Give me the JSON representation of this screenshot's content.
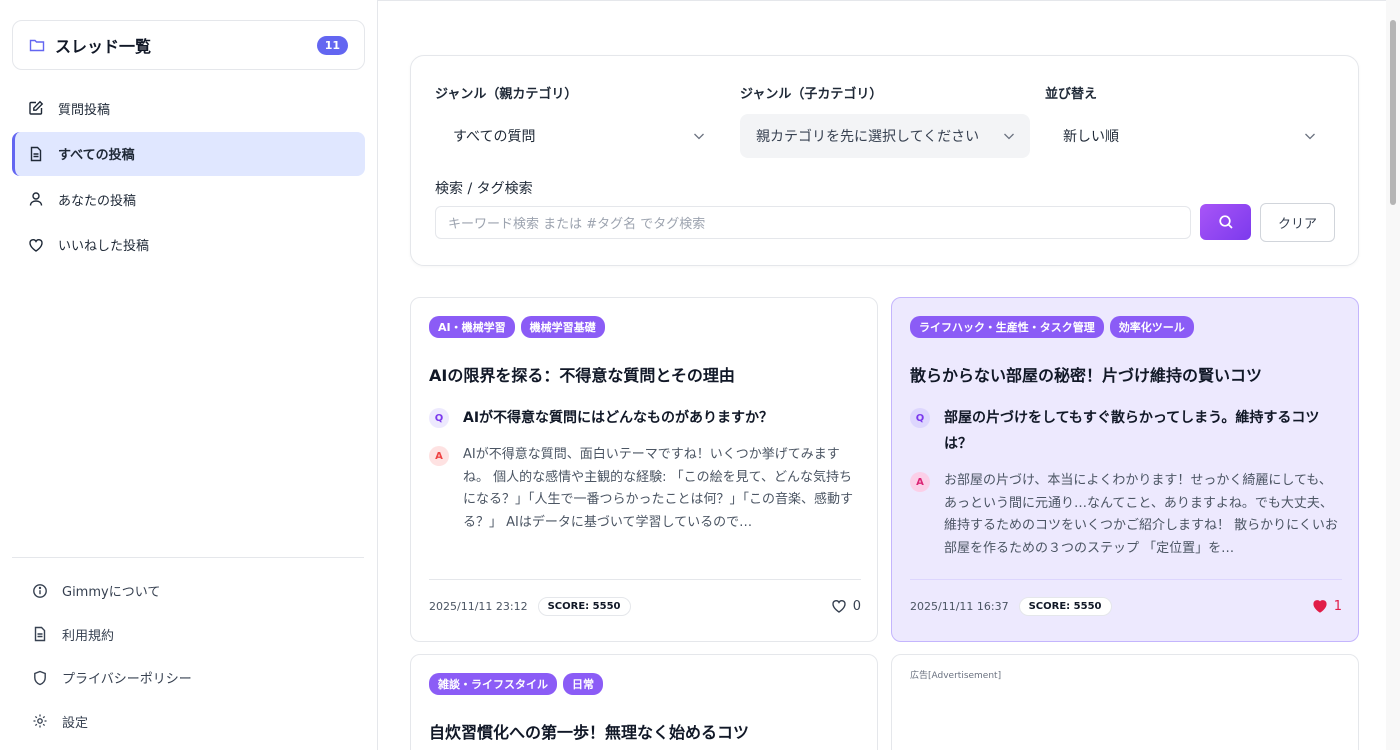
{
  "sidebar": {
    "header": {
      "title": "スレッド一覧",
      "count": "11",
      "icon": "folder-icon"
    },
    "nav": [
      {
        "label": "質問投稿",
        "icon": "edit-icon",
        "active": false
      },
      {
        "label": "すべての投稿",
        "icon": "document-icon",
        "active": true
      },
      {
        "label": "あなたの投稿",
        "icon": "user-icon",
        "active": false
      },
      {
        "label": "いいねした投稿",
        "icon": "heart-icon",
        "active": false
      }
    ],
    "footer": [
      {
        "label": "Gimmyについて",
        "icon": "info-icon"
      },
      {
        "label": "利用規約",
        "icon": "document-icon"
      },
      {
        "label": "プライバシーポリシー",
        "icon": "shield-icon"
      },
      {
        "label": "設定",
        "icon": "gear-icon"
      }
    ]
  },
  "filters": {
    "parent_label": "ジャンル（親カテゴリ）",
    "parent_value": "すべての質問",
    "child_label": "ジャンル（子カテゴリ）",
    "child_value": "親カテゴリを先に選択してください",
    "sort_label": "並び替え",
    "sort_value": "新しい順",
    "search_label": "検索 / タグ検索",
    "search_placeholder": "キーワード検索 または #タグ名 でタグ検索",
    "search_value": "",
    "clear_label": "クリア"
  },
  "posts": [
    {
      "tags": [
        "AI・機械学習",
        "機械学習基礎"
      ],
      "title": "AIの限界を探る：不得意な質問とその理由",
      "q_badge": "Q",
      "question": "AIが不得意な質問にはどんなものがありますか？",
      "a_badge": "A",
      "answer": "AIが不得意な質問、面白いテーマですね！いくつか挙げてみますね。 個人的な感情や主観的な経験: 「この絵を見て、どんな気持ちになる？」「人生で一番つらかったことは何？」「この音楽、感動する？」 AIはデータに基づいて学習しているので…",
      "date": "2025/11/11 23:12",
      "score_label": "SCORE:",
      "score": "5550",
      "likes": "0",
      "liked": false
    },
    {
      "tags": [
        "ライフハック・生産性・タスク管理",
        "効率化ツール"
      ],
      "title": "散らからない部屋の秘密！片づけ維持の賢いコツ",
      "q_badge": "Q",
      "question": "部屋の片づけをしてもすぐ散らかってしまう。維持するコツは？",
      "a_badge": "A",
      "answer": "お部屋の片づけ、本当によくわかります！せっかく綺麗にしても、あっという間に元通り…なんてこと、ありますよね。でも大丈夫、維持するためのコツをいくつかご紹介しますね！ 散らかりにくいお部屋を作るための３つのステップ 「定位置」を…",
      "date": "2025/11/11 16:37",
      "score_label": "SCORE:",
      "score": "5550",
      "likes": "1",
      "liked": true
    },
    {
      "tags": [
        "雑談・ライフスタイル",
        "日常"
      ],
      "title": "自炊習慣化への第一歩！無理なく始めるコツ"
    }
  ],
  "ad": {
    "label": "広告[Advertisement]"
  }
}
